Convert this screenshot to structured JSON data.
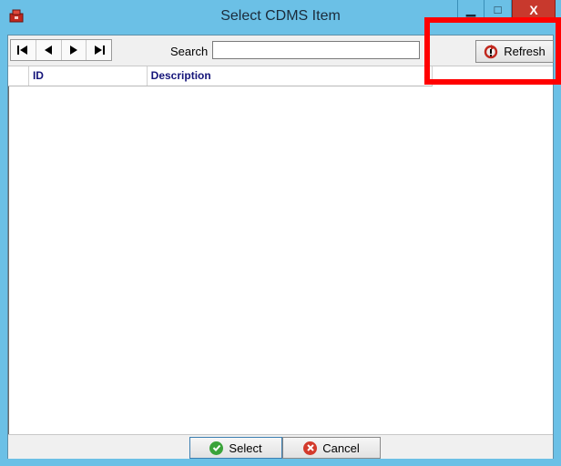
{
  "window": {
    "title": "Select CDMS Item",
    "minimize_glyph": "▁",
    "maximize_glyph": "□",
    "close_glyph": "X",
    "accent": "#6bc0e6",
    "close_color": "#c8392d"
  },
  "toolbar": {
    "nav": [
      {
        "icon": "first-record-icon",
        "glyph": "|◀"
      },
      {
        "icon": "previous-record-icon",
        "glyph": "◀"
      },
      {
        "icon": "next-record-icon",
        "glyph": "▶"
      },
      {
        "icon": "last-record-icon",
        "glyph": "▶|"
      }
    ],
    "search_label": "Search",
    "search_value": "",
    "refresh_label": "Refresh",
    "refresh_icon": "refresh-icon"
  },
  "grid": {
    "columns": [
      "ID",
      "Description"
    ],
    "rows": []
  },
  "footer": {
    "select_label": "Select",
    "select_icon": "checkmark-icon",
    "cancel_label": "Cancel",
    "cancel_icon": "cancel-icon"
  },
  "highlight_color": "#ff0000"
}
